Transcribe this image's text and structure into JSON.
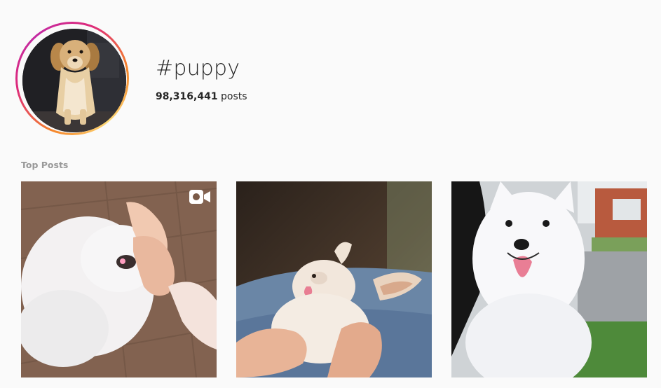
{
  "header": {
    "hashtag": "#puppy",
    "post_count": "98,316,441",
    "post_count_label": "posts",
    "avatar_icon": "golden-retriever-photo"
  },
  "sections": {
    "top_posts_label": "Top Posts"
  },
  "posts": [
    {
      "subject": "white fluffy puppy being pinched",
      "media_type": "video",
      "badge_icon": "video-camera-icon"
    },
    {
      "subject": "chihuahua puppy sleeping in hands",
      "media_type": "photo"
    },
    {
      "subject": "white samoyed puppy on lawn",
      "media_type": "photo"
    }
  ],
  "colors": {
    "background": "#fafafa",
    "text": "#262626",
    "muted": "#999999",
    "ring_start": "#f58529",
    "ring_end": "#dd2a7b"
  }
}
